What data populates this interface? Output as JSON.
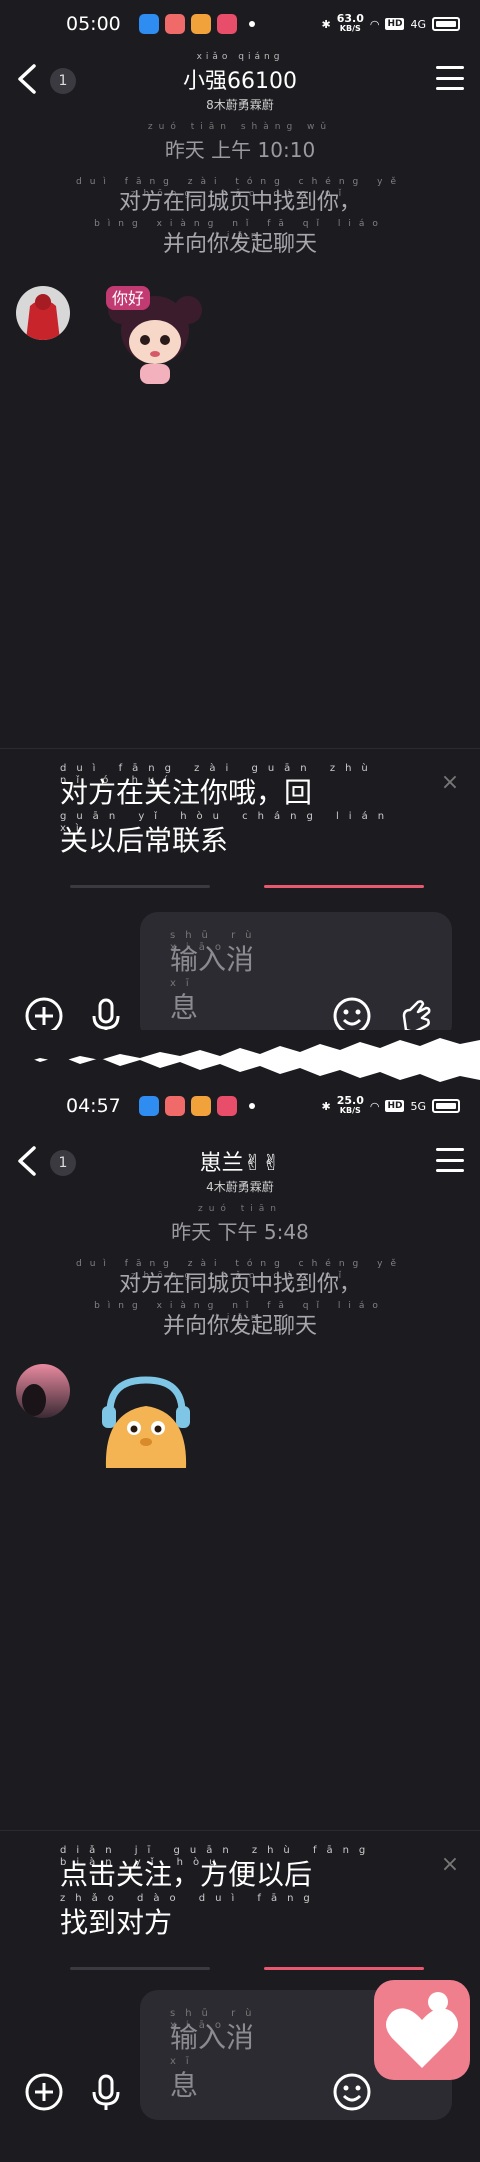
{
  "screens": [
    {
      "status": {
        "time": "05:00",
        "speed": "63.0",
        "speed_unit": "KB/S",
        "hd": "HD",
        "net": "4G"
      },
      "header": {
        "back_count": "1",
        "name_pinyin": "xiǎo qiáng",
        "name": "小强66100",
        "subtitle": "8木蔚勇霖蔚"
      },
      "timestamp": {
        "pinyin": "zuó tiān shàng wǔ",
        "text": "昨天 上午 10:10"
      },
      "system_message": {
        "line1_pinyin": "duì fāng zài tóng chéng yě zhōng zhǎo dào nǐ",
        "line1": "对方在同城页中找到你，",
        "line2_pinyin": "bìng xiàng nǐ fā qǐ liáo tiān",
        "line2": "并向你发起聊天"
      },
      "sticker_text": "你好",
      "follow_bar": {
        "line1_pinyin": "duì fāng zài guān zhù nǐ ó       huí",
        "line1": "对方在关注你哦，回",
        "line2_pinyin": "guān yǐ hòu cháng lián xì",
        "line2": "关以后常联系",
        "close": "×"
      },
      "input": {
        "placeholder_pinyin": "shū rù xiāo",
        "placeholder_line1": "输入消",
        "placeholder_pinyin2": "xī",
        "placeholder_line2": "息"
      }
    },
    {
      "status": {
        "time": "04:57",
        "speed": "25.0",
        "speed_unit": "KB/S",
        "hd": "HD",
        "net": "5G"
      },
      "header": {
        "back_count": "1",
        "name_pinyin": "",
        "name": "崽兰✌✌",
        "subtitle": "4木蔚勇霖蔚"
      },
      "timestamp": {
        "pinyin": "zuó tiān",
        "text": "昨天 下午 5:48"
      },
      "system_message": {
        "line1_pinyin": "duì fāng zài tóng chéng yě zhōng zhǎo dào nǐ",
        "line1": "对方在同城页中找到你，",
        "line2_pinyin": "bìng xiàng nǐ fā qǐ liáo tiān",
        "line2": "并向你发起聊天"
      },
      "follow_bar": {
        "line1_pinyin": "diǎn jī guān zhù   fāng biàn yǐ hòu",
        "line1": "点击关注，方便以后",
        "line2_pinyin": "zhǎo dào duì fāng",
        "line2": "找到对方",
        "close": "×"
      },
      "input": {
        "placeholder_pinyin": "shū rù xiāo",
        "placeholder_line1": "输入消",
        "placeholder_pinyin2": "xī",
        "placeholder_line2": "息"
      }
    }
  ],
  "colors": {
    "background": "#1c1c20",
    "accent_pink": "#e8586e",
    "heart_fab": "#f07f8e"
  },
  "icons": [
    "back-icon",
    "menu-icon",
    "plus-icon",
    "microphone-icon",
    "emoji-icon",
    "finger-heart-icon",
    "heart-icon",
    "close-icon"
  ]
}
